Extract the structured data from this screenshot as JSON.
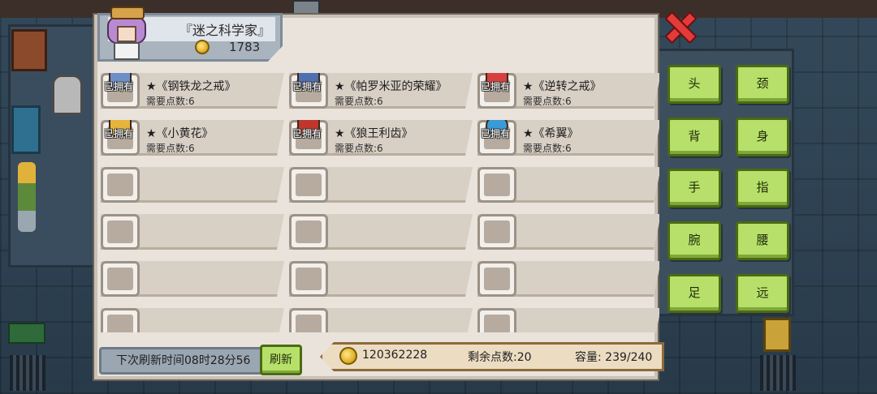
{
  "header": {
    "character_title": "『迷之科学家』",
    "gold": "1783"
  },
  "items": [
    {
      "owned_label": "已拥有",
      "name": "★《钢铁龙之戒》",
      "cost": "需要点数:6",
      "gem_color": "#6c8fc8"
    },
    {
      "owned_label": "已拥有",
      "name": "★《帕罗米亚的荣耀》",
      "cost": "需要点数:6",
      "gem_color": "#4f6fb0"
    },
    {
      "owned_label": "已拥有",
      "name": "★《逆转之戒》",
      "cost": "需要点数:6",
      "gem_color": "#d84040"
    },
    {
      "owned_label": "已拥有",
      "name": "★《小黄花》",
      "cost": "需要点数:6",
      "gem_color": "#e6b43a"
    },
    {
      "owned_label": "已拥有",
      "name": "★《狼王利齿》",
      "cost": "需要点数:6",
      "gem_color": "#c0362c"
    },
    {
      "owned_label": "已拥有",
      "name": "★《希翼》",
      "cost": "需要点数:6",
      "gem_color": "#3a9ad8"
    }
  ],
  "footer": {
    "refresh_time_label": "下次刷新时间08时28分56",
    "refresh_button": "刷新",
    "total_gold": "120362228",
    "remaining_points": "剩余点数:20",
    "capacity": "容量: 239/240"
  },
  "categories": [
    "头",
    "颈",
    "背",
    "身",
    "手",
    "指",
    "腕",
    "腰",
    "足",
    "远"
  ],
  "colors": {
    "button_green": "#b7e06a",
    "close_red": "#e33a3a",
    "panel_bg": "#e9e3dc"
  }
}
